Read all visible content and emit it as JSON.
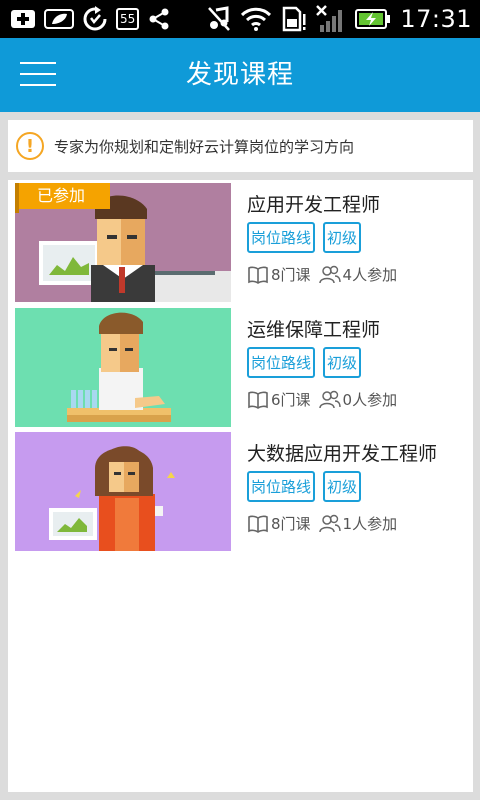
{
  "status_bar": {
    "badge_count": "55",
    "time": "17:31",
    "left_icons": [
      "add-icon",
      "leaf-icon",
      "sync-icon",
      "notification-count-badge",
      "share-icon"
    ],
    "right_icons": [
      "music-muted-icon",
      "wifi-icon",
      "sd-card-icon",
      "signal-icon",
      "battery-charging-icon"
    ]
  },
  "app_bar": {
    "title": "发现课程",
    "menu_icon": "hamburger-menu-icon"
  },
  "notice": {
    "icon": "exclamation-icon",
    "text": "专家为你规划和定制好云计算岗位的学习方向"
  },
  "courses": [
    {
      "title": "应用开发工程师",
      "joined_badge": "已参加",
      "tags": [
        "岗位路线",
        "初级"
      ],
      "courses_count": "8门课",
      "participants": "4人参加"
    },
    {
      "title": "运维保障工程师",
      "tags": [
        "岗位路线",
        "初级"
      ],
      "courses_count": "6门课",
      "participants": "0人参加"
    },
    {
      "title": "大数据应用开发工程师",
      "tags": [
        "岗位路线",
        "初级"
      ],
      "courses_count": "8门课",
      "participants": "1人参加"
    }
  ],
  "colors": {
    "primary": "#0f9ad8",
    "tag_blue": "#1a9fd9",
    "badge_orange": "#f5a300",
    "notice_orange": "#f5a623",
    "thumb1_bg": "#b07fa0",
    "thumb2_bg": "#6ddfb0",
    "thumb3_bg": "#c69bef"
  }
}
